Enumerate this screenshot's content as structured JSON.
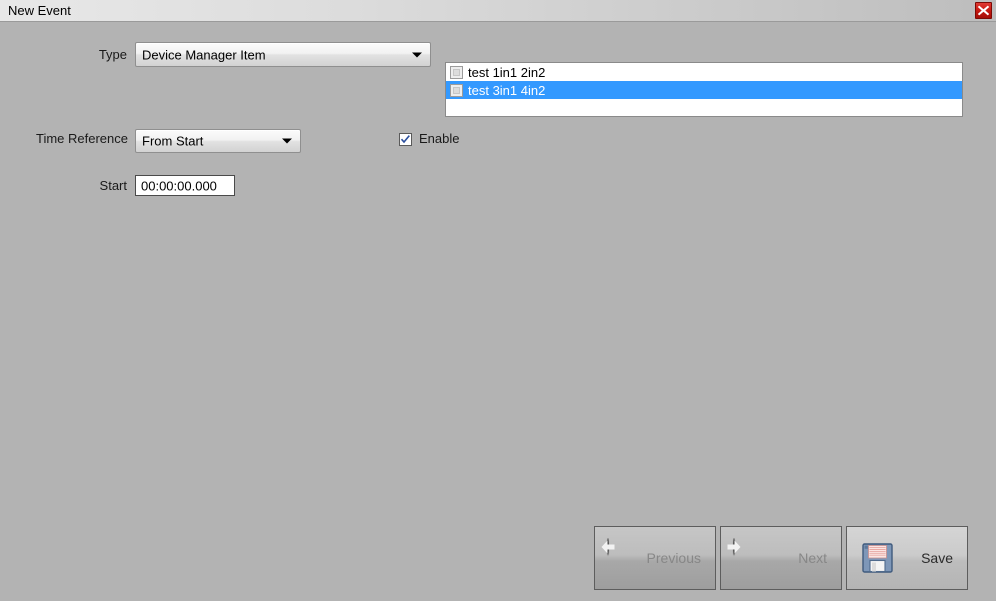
{
  "window": {
    "title": "New Event",
    "close_icon": "close-x-icon",
    "background_color": "#b3b3b3"
  },
  "form": {
    "type": {
      "label": "Type",
      "value": "Device Manager Item",
      "arrow_icon": "chevron-down-icon"
    },
    "time_reference": {
      "label": "Time Reference",
      "value": "From Start",
      "arrow_icon": "chevron-down-icon"
    },
    "start": {
      "label": "Start",
      "value": "00:00:00.000",
      "placeholder": "00:00:00.000"
    },
    "enable": {
      "label": "Enable",
      "checked": true,
      "check_icon": "checkmark-icon",
      "check_color": "#2b4f9e"
    }
  },
  "item_list": {
    "rows": [
      {
        "label": "test 1in1 2in2",
        "checked": false,
        "selected": false,
        "checkbox_icon": "checkbox-unchecked-icon"
      },
      {
        "label": "test 3in1 4in2",
        "checked": false,
        "selected": true,
        "checkbox_icon": "checkbox-unchecked-icon"
      }
    ],
    "selection_color": "#3399ff"
  },
  "footer": {
    "buttons": [
      {
        "label": "Previous",
        "icon": "arrow-left-circle-icon",
        "enabled": false
      },
      {
        "label": "Next",
        "icon": "arrow-right-circle-icon",
        "enabled": false
      },
      {
        "label": "Save",
        "icon": "floppy-disk-icon",
        "enabled": true
      }
    ]
  }
}
